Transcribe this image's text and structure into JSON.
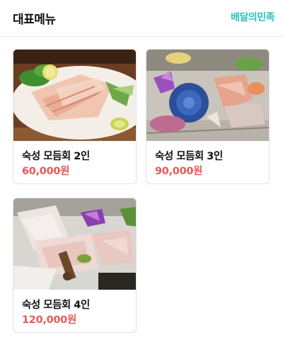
{
  "header": {
    "title": "대표메뉴",
    "brand": "배달의민족",
    "brand_color": "#2ac1bc"
  },
  "menu": {
    "items": [
      {
        "name": "숙성 모듬회 2인",
        "price": "60,000원",
        "image": "sashimi-platter-2-photo"
      },
      {
        "name": "숙성 모듬회 3인",
        "price": "90,000원",
        "image": "sashimi-platter-3-photo"
      },
      {
        "name": "숙성 모듬회 4인",
        "price": "120,000원",
        "image": "sashimi-platter-4-photo"
      }
    ],
    "price_color": "#e65a5a"
  }
}
